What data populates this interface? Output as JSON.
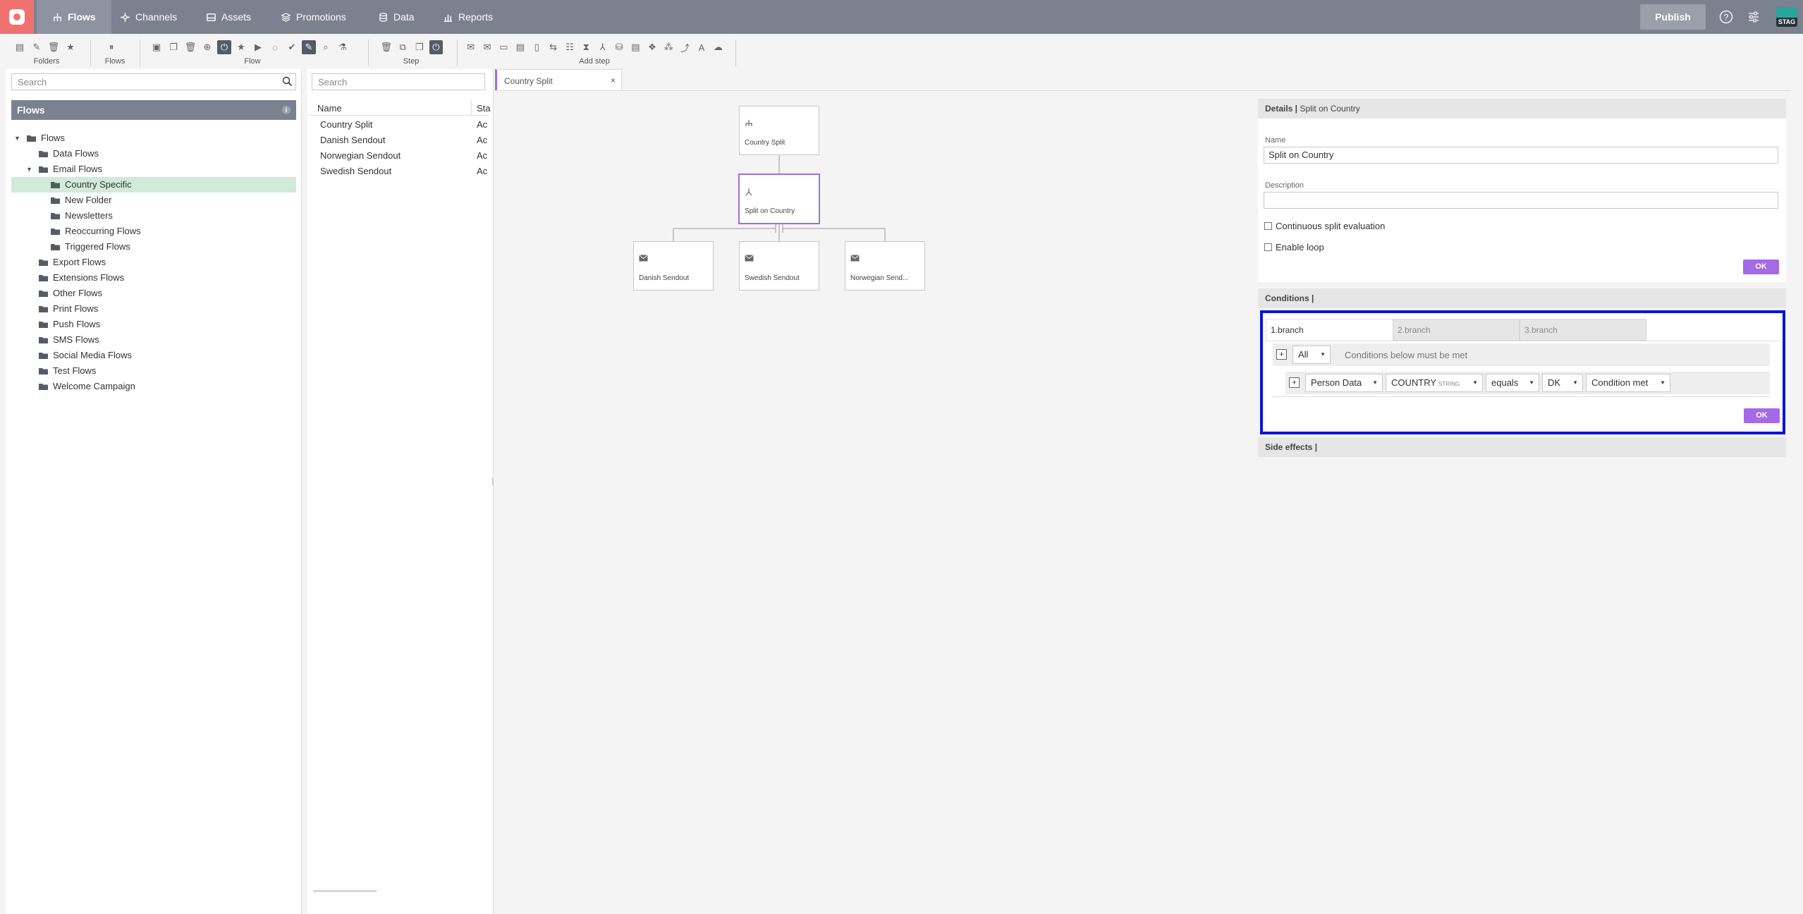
{
  "nav": {
    "items": [
      {
        "label": "Flows",
        "icon": "flows-icon",
        "active": true
      },
      {
        "label": "Channels",
        "icon": "channels-icon",
        "active": false
      },
      {
        "label": "Assets",
        "icon": "assets-icon",
        "active": false
      },
      {
        "label": "Promotions",
        "icon": "promotions-icon",
        "active": false
      },
      {
        "label": "Data",
        "icon": "data-icon",
        "active": false
      },
      {
        "label": "Reports",
        "icon": "reports-icon",
        "active": false
      }
    ],
    "publish_label": "Publish",
    "env_badge": "STAG",
    "colors": {
      "bar": "#7c8190",
      "logo": "#f0726f",
      "accent": "#a56ae6",
      "highlight": "#0a13d8",
      "selected_row": "#d1ead9"
    }
  },
  "toolbar": {
    "groups": [
      {
        "label": "Folders"
      },
      {
        "label": "Flows"
      },
      {
        "label": "Flow"
      },
      {
        "label": "Step"
      },
      {
        "label": "Add step"
      }
    ]
  },
  "folders": {
    "search_placeholder": "Search",
    "header": "Flows",
    "tree": [
      {
        "label": "Flows",
        "level": 0,
        "expanded": true
      },
      {
        "label": "Data Flows",
        "level": 1
      },
      {
        "label": "Email Flows",
        "level": 1,
        "expanded": true
      },
      {
        "label": "Country Specific",
        "level": 2,
        "selected": true
      },
      {
        "label": "New Folder",
        "level": 2
      },
      {
        "label": "Newsletters",
        "level": 2
      },
      {
        "label": "Reoccurring Flows",
        "level": 2
      },
      {
        "label": "Triggered Flows",
        "level": 2
      },
      {
        "label": "Export Flows",
        "level": 1
      },
      {
        "label": "Extensions Flows",
        "level": 1
      },
      {
        "label": "Other Flows",
        "level": 1
      },
      {
        "label": "Print Flows",
        "level": 1
      },
      {
        "label": "Push Flows",
        "level": 1
      },
      {
        "label": "SMS Flows",
        "level": 1
      },
      {
        "label": "Social Media Flows",
        "level": 1
      },
      {
        "label": "Test Flows",
        "level": 1
      },
      {
        "label": "Welcome Campaign",
        "level": 1
      }
    ]
  },
  "flow_list": {
    "search_placeholder": "Search",
    "columns": [
      "Name",
      "Sta"
    ],
    "rows": [
      {
        "name": "Country Split",
        "status": "Ac"
      },
      {
        "name": "Danish Sendout",
        "status": "Ac"
      },
      {
        "name": "Norwegian Sendout",
        "status": "Ac"
      },
      {
        "name": "Swedish Sendout",
        "status": "Ac"
      }
    ]
  },
  "editor": {
    "tab_label": "Country Split",
    "close_glyph": "×",
    "nodes": {
      "root": {
        "label": "Country Split",
        "icon": "flow-start-icon"
      },
      "split": {
        "label": "Split on Country",
        "icon": "split-icon"
      },
      "branches": [
        {
          "label": "Danish Sendout",
          "icon": "email-icon"
        },
        {
          "label": "Swedish Sendout",
          "icon": "email-icon"
        },
        {
          "label": "Norwegian Send...",
          "icon": "email-icon"
        }
      ]
    }
  },
  "details": {
    "title": "Details |",
    "subtitle": "Split on Country",
    "name_label": "Name",
    "name_value": "Split on Country",
    "description_label": "Description",
    "description_value": "",
    "continuous_label": "Continuous split evaluation",
    "loop_label": "Enable loop",
    "ok_label": "OK"
  },
  "conditions": {
    "title": "Conditions |",
    "tabs": [
      "1.branch",
      "2.branch",
      "3.branch"
    ],
    "group_mode": "All",
    "group_text": "Conditions below must be met",
    "rule": {
      "source": "Person Data",
      "field": "COUNTRY",
      "field_type": "STRING",
      "operator": "equals",
      "value": "DK",
      "mode": "Condition met"
    },
    "ok_label": "OK"
  },
  "side_effects": {
    "title": "Side effects |"
  }
}
